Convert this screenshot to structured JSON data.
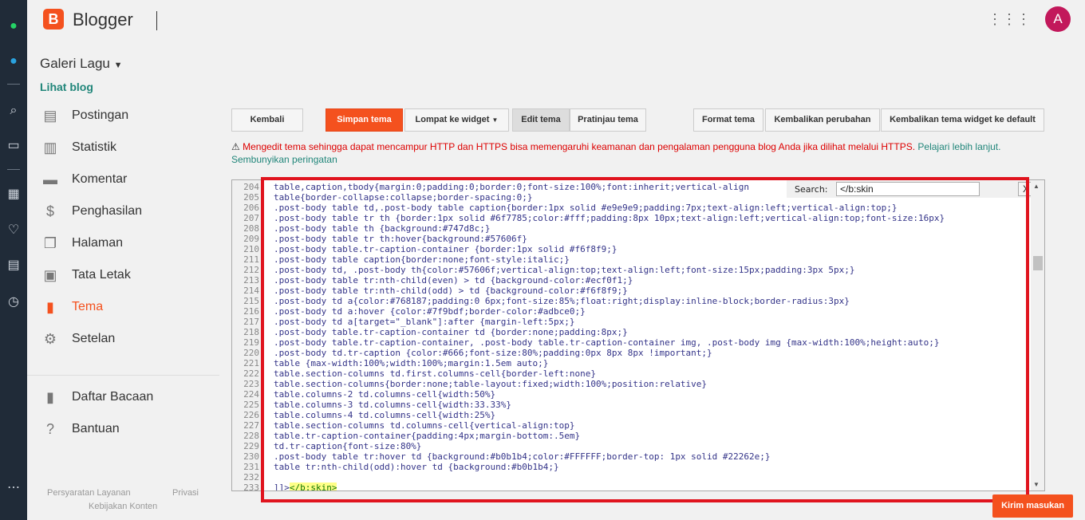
{
  "header": {
    "brand": "Blogger",
    "avatar_letter": "A"
  },
  "sidebar": {
    "blog_name": "Galeri Lagu",
    "view_blog": "Lihat blog",
    "items": [
      {
        "label": "Postingan",
        "icon": "posts-icon"
      },
      {
        "label": "Statistik",
        "icon": "stats-icon"
      },
      {
        "label": "Komentar",
        "icon": "comment-icon"
      },
      {
        "label": "Penghasilan",
        "icon": "dollar-icon"
      },
      {
        "label": "Halaman",
        "icon": "pages-icon"
      },
      {
        "label": "Tata Letak",
        "icon": "layout-icon"
      },
      {
        "label": "Tema",
        "icon": "theme-icon"
      },
      {
        "label": "Setelan",
        "icon": "gear-icon"
      }
    ],
    "secondary": [
      {
        "label": "Daftar Bacaan",
        "icon": "bookmark-icon"
      },
      {
        "label": "Bantuan",
        "icon": "help-icon"
      }
    ],
    "footer": {
      "terms": "Persyaratan Layanan",
      "privacy": "Privasi",
      "content_policy": "Kebijakan Konten"
    }
  },
  "toolbar": {
    "back": "Kembali",
    "save": "Simpan tema",
    "jump": "Lompat ke widget",
    "edit": "Edit tema",
    "preview": "Pratinjau tema",
    "format": "Format tema",
    "revert": "Kembalikan perubahan",
    "revert_widgets": "Kembalikan tema widget ke default"
  },
  "warning": {
    "text": "Mengedit tema sehingga dapat mencampur HTTP dan HTTPS bisa memengaruhi keamanan dan pengalaman pengguna blog Anda jika dilihat melalui HTTPS.",
    "learn_more": "Pelajari lebih lanjut.",
    "hide": "Sembunyikan peringatan"
  },
  "search": {
    "label": "Search:",
    "value": "</b:skin",
    "close": "X"
  },
  "code_lines": [
    {
      "n": "204",
      "t": "table,caption,tbody{margin:0;padding:0;border:0;font-size:100%;font:inherit;vertical-align"
    },
    {
      "n": "205",
      "t": "table{border-collapse:collapse;border-spacing:0;}"
    },
    {
      "n": "206",
      "t": ".post-body table td,.post-body table caption{border:1px solid #e9e9e9;padding:7px;text-align:left;vertical-align:top;}"
    },
    {
      "n": "207",
      "t": ".post-body table tr th {border:1px solid #6f7785;color:#fff;padding:8px 10px;text-align:left;vertical-align:top;font-size:16px}"
    },
    {
      "n": "208",
      "t": ".post-body table th {background:#747d8c;}"
    },
    {
      "n": "209",
      "t": ".post-body table tr th:hover{background:#57606f}"
    },
    {
      "n": "210",
      "t": ".post-body table.tr-caption-container {border:1px solid #f6f8f9;}"
    },
    {
      "n": "211",
      "t": ".post-body table caption{border:none;font-style:italic;}"
    },
    {
      "n": "212",
      "t": ".post-body td, .post-body th{color:#57606f;vertical-align:top;text-align:left;font-size:15px;padding:3px 5px;}"
    },
    {
      "n": "213",
      "t": ".post-body table tr:nth-child(even) > td {background-color:#ecf0f1;}"
    },
    {
      "n": "214",
      "t": ".post-body table tr:nth-child(odd) > td {background-color:#f6f8f9;}"
    },
    {
      "n": "215",
      "t": ".post-body td a{color:#768187;padding:0 6px;font-size:85%;float:right;display:inline-block;border-radius:3px}"
    },
    {
      "n": "216",
      "t": ".post-body td a:hover {color:#7f9bdf;border-color:#adbce0;}"
    },
    {
      "n": "217",
      "t": ".post-body td a[target=\"_blank\"]:after {margin-left:5px;}"
    },
    {
      "n": "218",
      "t": ".post-body table.tr-caption-container td {border:none;padding:8px;}"
    },
    {
      "n": "219",
      "t": ".post-body table.tr-caption-container, .post-body table.tr-caption-container img, .post-body img {max-width:100%;height:auto;}"
    },
    {
      "n": "220",
      "t": ".post-body td.tr-caption {color:#666;font-size:80%;padding:0px 8px 8px !important;}"
    },
    {
      "n": "221",
      "t": "table {max-width:100%;width:100%;margin:1.5em auto;}"
    },
    {
      "n": "222",
      "t": "table.section-columns td.first.columns-cell{border-left:none}"
    },
    {
      "n": "223",
      "t": "table.section-columns{border:none;table-layout:fixed;width:100%;position:relative}"
    },
    {
      "n": "224",
      "t": "table.columns-2 td.columns-cell{width:50%}"
    },
    {
      "n": "225",
      "t": "table.columns-3 td.columns-cell{width:33.33%}"
    },
    {
      "n": "226",
      "t": "table.columns-4 td.columns-cell{width:25%}"
    },
    {
      "n": "227",
      "t": "table.section-columns td.columns-cell{vertical-align:top}"
    },
    {
      "n": "228",
      "t": "table.tr-caption-container{padding:4px;margin-bottom:.5em}"
    },
    {
      "n": "229",
      "t": "td.tr-caption{font-size:80%}"
    },
    {
      "n": "230",
      "t": ".post-body table tr:hover td {background:#b0b1b4;color:#FFFFFF;border-top: 1px solid #22262e;}"
    },
    {
      "n": "231",
      "t": "table tr:nth-child(odd):hover td {background:#b0b1b4;}"
    },
    {
      "n": "232",
      "t": ""
    },
    {
      "n": "233",
      "t": "]]>",
      "hl": "</b:skin>"
    }
  ],
  "feedback": "Kirim masukan",
  "colors": {
    "accent": "#f4511e",
    "link": "#21867a",
    "highlight": "#e0141e"
  }
}
